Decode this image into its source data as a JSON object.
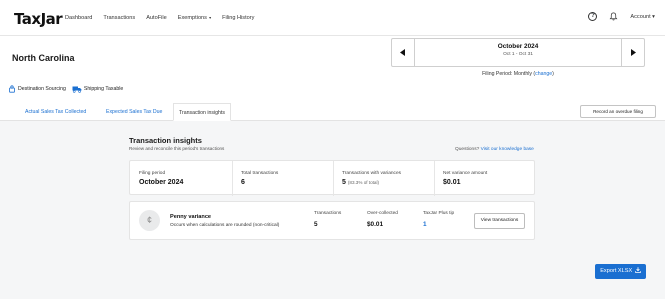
{
  "app": {
    "logo": "TaxJar"
  },
  "nav": {
    "items": [
      {
        "label": "Dashboard"
      },
      {
        "label": "Transactions"
      },
      {
        "label": "AutoFile"
      },
      {
        "label": "Exemptions",
        "dropdown": true
      },
      {
        "label": "Filing History"
      }
    ],
    "account_label": "Account"
  },
  "header": {
    "state": "North Carolina",
    "period": {
      "month": "October 2024",
      "range": "Oct 1 - Oct 31",
      "filing_period_label": "Filing Period: Monthly",
      "change_link": "change"
    }
  },
  "badges": [
    {
      "icon": "sourcing-icon",
      "label": "Destination Sourcing"
    },
    {
      "icon": "truck-icon",
      "label": "Shipping Taxable"
    }
  ],
  "tabs": [
    {
      "label": "Actual Sales Tax Collected",
      "active": false
    },
    {
      "label": "Expected Sales Tax Due",
      "active": false
    },
    {
      "label": "Transaction insights",
      "active": true
    }
  ],
  "overdue_button": "Record an overdue filing",
  "insights": {
    "title": "Transaction insights",
    "subtitle": "Review and reconcile this period's transactions",
    "questions_text": "Questions?",
    "knowledge_link": "Visit our knowledge base",
    "stats": [
      {
        "label": "Filing period",
        "value": "October 2024"
      },
      {
        "label": "Total transactions",
        "value": "6"
      },
      {
        "label": "Transactions with variances",
        "value": "5",
        "extra": "(83.3% of total)"
      },
      {
        "label": "Net variance amount",
        "value": "$0.01"
      }
    ],
    "variance": {
      "title": "Penny variance",
      "description": "Occurs when calculations are rounded (non-critical)",
      "columns": [
        {
          "label": "Transactions",
          "value": "5"
        },
        {
          "label": "Over-collected",
          "value": "$0.01"
        },
        {
          "label": "TaxJar Plus tip",
          "value": "1"
        }
      ],
      "button": "View transactions"
    }
  },
  "export_button": "Export XLSX",
  "colors": {
    "accent": "#1a6fd1",
    "background": "#f5f6f7"
  }
}
